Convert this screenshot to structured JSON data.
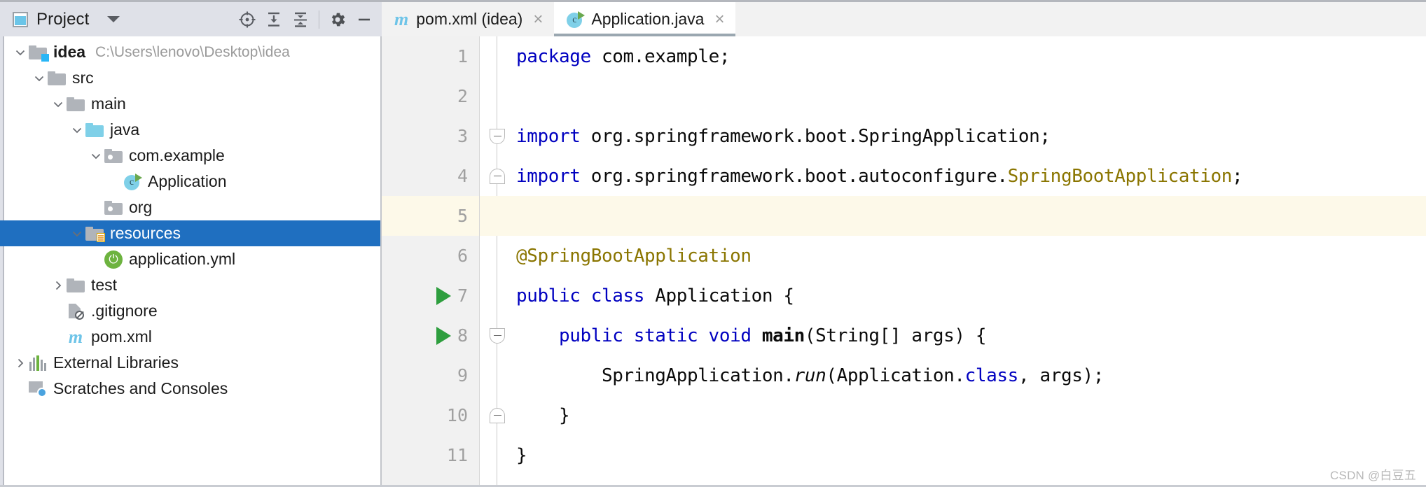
{
  "toolwindow": {
    "title": "Project",
    "icon": "project-window-icon",
    "dropdown_icon": "chevron-down-icon",
    "actions": [
      {
        "name": "locate-icon",
        "tooltip": "Select Opened File"
      },
      {
        "name": "expand-all-icon",
        "tooltip": "Expand All"
      },
      {
        "name": "collapse-all-icon",
        "tooltip": "Collapse All"
      },
      {
        "name": "gear-icon",
        "tooltip": "Settings"
      },
      {
        "name": "minimize-icon",
        "tooltip": "Hide"
      }
    ]
  },
  "tabs": [
    {
      "label": "pom.xml (idea)",
      "icon": "maven-icon",
      "active": false,
      "close": "×"
    },
    {
      "label": "Application.java",
      "icon": "java-class-icon",
      "active": true,
      "close": "×"
    }
  ],
  "tree": [
    {
      "label": "idea",
      "sub": "C:\\Users\\lenovo\\Desktop\\idea",
      "icon": "module-folder-icon",
      "indent": 0,
      "arrow": "expanded",
      "bold": true,
      "selected": false
    },
    {
      "label": "src",
      "sub": "",
      "icon": "folder-icon",
      "indent": 1,
      "arrow": "expanded",
      "bold": false,
      "selected": false
    },
    {
      "label": "main",
      "sub": "",
      "icon": "folder-icon",
      "indent": 2,
      "arrow": "expanded",
      "bold": false,
      "selected": false
    },
    {
      "label": "java",
      "sub": "",
      "icon": "source-folder-icon",
      "indent": 3,
      "arrow": "expanded",
      "bold": false,
      "selected": false
    },
    {
      "label": "com.example",
      "sub": "",
      "icon": "package-icon",
      "indent": 4,
      "arrow": "expanded",
      "bold": false,
      "selected": false
    },
    {
      "label": "Application",
      "sub": "",
      "icon": "java-class-icon",
      "indent": 5,
      "arrow": "none",
      "bold": false,
      "selected": false
    },
    {
      "label": "org",
      "sub": "",
      "icon": "package-icon",
      "indent": 4,
      "arrow": "none",
      "bold": false,
      "selected": false
    },
    {
      "label": "resources",
      "sub": "",
      "icon": "resources-folder-icon",
      "indent": 3,
      "arrow": "expanded",
      "bold": false,
      "selected": true
    },
    {
      "label": "application.yml",
      "sub": "",
      "icon": "spring-yaml-icon",
      "indent": 4,
      "arrow": "none",
      "bold": false,
      "selected": false
    },
    {
      "label": "test",
      "sub": "",
      "icon": "folder-icon",
      "indent": 2,
      "arrow": "collapsed",
      "bold": false,
      "selected": false
    },
    {
      "label": ".gitignore",
      "sub": "",
      "icon": "gitignore-file-icon",
      "indent": 2,
      "arrow": "none",
      "bold": false,
      "selected": false
    },
    {
      "label": "pom.xml",
      "sub": "",
      "icon": "maven-icon",
      "indent": 2,
      "arrow": "none",
      "bold": false,
      "selected": false
    },
    {
      "label": "External Libraries",
      "sub": "",
      "icon": "libraries-icon",
      "indent": 0,
      "arrow": "collapsed",
      "bold": false,
      "selected": false
    },
    {
      "label": "Scratches and Consoles",
      "sub": "",
      "icon": "scratches-icon",
      "indent": 0,
      "arrow": "none",
      "bold": false,
      "selected": false
    }
  ],
  "editor": {
    "lines": [
      {
        "num": "1",
        "highlight": false,
        "run": false,
        "fold": "",
        "tokens": [
          {
            "t": "package",
            "c": "kw"
          },
          {
            "t": " com.example;",
            "c": ""
          }
        ]
      },
      {
        "num": "2",
        "highlight": false,
        "run": false,
        "fold": "",
        "tokens": [
          {
            "t": "",
            "c": ""
          }
        ]
      },
      {
        "num": "3",
        "highlight": false,
        "run": false,
        "fold": "down",
        "tokens": [
          {
            "t": "import",
            "c": "kw"
          },
          {
            "t": " org.springframework.boot.SpringApplication;",
            "c": ""
          }
        ]
      },
      {
        "num": "4",
        "highlight": false,
        "run": false,
        "fold": "up",
        "tokens": [
          {
            "t": "import",
            "c": "kw"
          },
          {
            "t": " org.springframework.boot.autoconfigure.",
            "c": ""
          },
          {
            "t": "SpringBootApplication",
            "c": "cls"
          },
          {
            "t": ";",
            "c": ""
          }
        ]
      },
      {
        "num": "5",
        "highlight": true,
        "run": false,
        "fold": "",
        "tokens": [
          {
            "t": "",
            "c": ""
          }
        ]
      },
      {
        "num": "6",
        "highlight": false,
        "run": false,
        "fold": "",
        "tokens": [
          {
            "t": "@SpringBootApplication",
            "c": "ann"
          }
        ]
      },
      {
        "num": "7",
        "highlight": false,
        "run": true,
        "fold": "",
        "tokens": [
          {
            "t": "public class",
            "c": "kw"
          },
          {
            "t": " Application {",
            "c": ""
          }
        ]
      },
      {
        "num": "8",
        "highlight": false,
        "run": true,
        "fold": "down",
        "tokens": [
          {
            "t": "    ",
            "c": ""
          },
          {
            "t": "public static void",
            "c": "kw"
          },
          {
            "t": " ",
            "c": ""
          },
          {
            "t": "main",
            "c": "b"
          },
          {
            "t": "(String[] args) {",
            "c": ""
          }
        ]
      },
      {
        "num": "9",
        "highlight": false,
        "run": false,
        "fold": "",
        "tokens": [
          {
            "t": "        SpringApplication.",
            "c": ""
          },
          {
            "t": "run",
            "c": "it"
          },
          {
            "t": "(Application.",
            "c": ""
          },
          {
            "t": "class",
            "c": "kw"
          },
          {
            "t": ", args);",
            "c": ""
          }
        ]
      },
      {
        "num": "10",
        "highlight": false,
        "run": false,
        "fold": "up",
        "tokens": [
          {
            "t": "    }",
            "c": ""
          }
        ]
      },
      {
        "num": "11",
        "highlight": false,
        "run": false,
        "fold": "",
        "tokens": [
          {
            "t": "}",
            "c": ""
          }
        ]
      }
    ],
    "watermark": "CSDN @白豆五"
  },
  "colors": {
    "selection": "#1f6fc0",
    "keyword": "#0000c0",
    "annotation": "#8a7500",
    "caret_line": "#fdf9e9",
    "toolbar_bg": "#dfe1e8",
    "run_green": "#2e9e3e",
    "spring_green": "#6db33f"
  }
}
